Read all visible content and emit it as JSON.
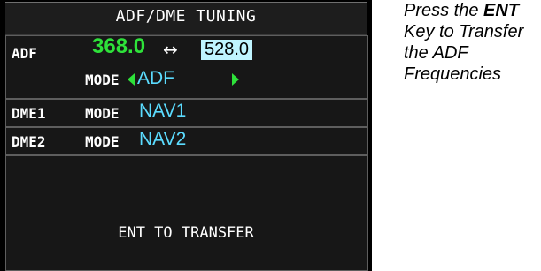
{
  "header": {
    "title": "ADF/DME TUNING"
  },
  "adf": {
    "label": "ADF",
    "active_freq": "368.0",
    "swap_symbol": "↔",
    "standby_freq": "528.0",
    "mode_label": "MODE",
    "mode_value": "ADF"
  },
  "dme1": {
    "label": "DME1",
    "mode_label": "MODE",
    "mode_value": "NAV1"
  },
  "dme2": {
    "label": "DME2",
    "mode_label": "MODE",
    "mode_value": "NAV2"
  },
  "footer": {
    "hint": "ENT TO TRANSFER"
  },
  "callout": {
    "prefix": "Press the ",
    "key": "ENT",
    "suffix": " Key to Transfer the ADF Frequencies"
  },
  "colors": {
    "active": "#2ee23a",
    "selectable": "#5bdcff",
    "highlight": "#bff4ff",
    "background": "#000000"
  }
}
